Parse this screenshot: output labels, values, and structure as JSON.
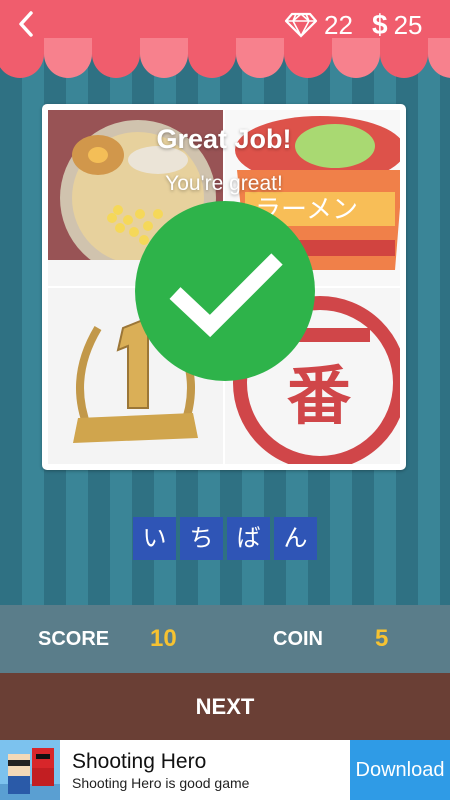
{
  "header": {
    "back_icon": "chevron-left-icon",
    "gems_icon": "diamond-icon",
    "gems": "22",
    "cash_symbol": "$",
    "cash": "25"
  },
  "overlay": {
    "title": "Great Job!",
    "subtitle": "You're great!",
    "check_icon": "checkmark-icon"
  },
  "answer": {
    "letters": [
      "い",
      "ち",
      "ば",
      "ん"
    ]
  },
  "stats": {
    "score_label": "SCORE",
    "score_value": "10",
    "coin_label": "COIN",
    "coin_value": "5"
  },
  "next_label": "NEXT",
  "ad": {
    "title": "Shooting Hero",
    "subtitle": "Shooting Hero is good game",
    "button": "Download"
  },
  "colors": {
    "header": "#f05d6d",
    "check": "#2eb34a",
    "letter_tile": "#2f55b6",
    "score_value": "#f6c231",
    "next_bar": "#6a3f35",
    "ad_button": "#2f9be6"
  },
  "tiles": [
    {
      "icon": "ramen-bowl-image"
    },
    {
      "icon": "cup-noodle-image"
    },
    {
      "icon": "gold-trophy-number-one-image"
    },
    {
      "icon": "ichiban-stamp-image"
    }
  ]
}
